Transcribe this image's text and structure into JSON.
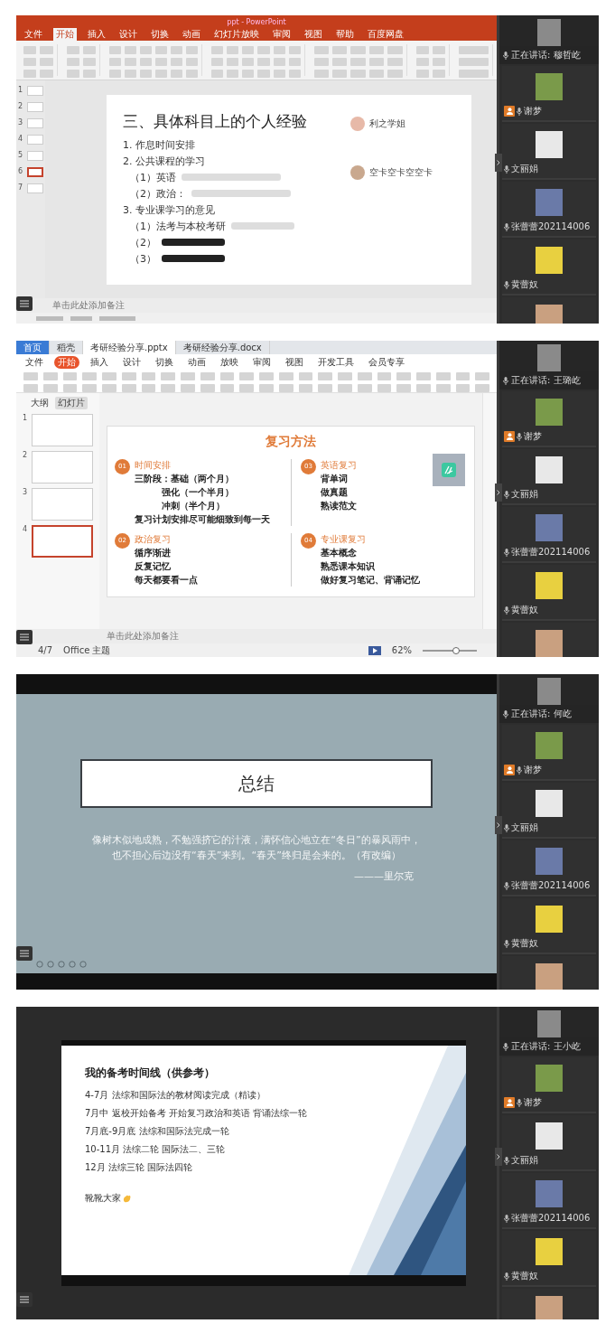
{
  "panels": [
    {
      "kind": "powerpoint",
      "title": "ppt - PowerPoint",
      "menu": [
        {
          "label": "文件",
          "selected": false
        },
        {
          "label": "开始",
          "selected": true
        },
        {
          "label": "插入",
          "selected": false
        },
        {
          "label": "设计",
          "selected": false
        },
        {
          "label": "切换",
          "selected": false
        },
        {
          "label": "动画",
          "selected": false
        },
        {
          "label": "幻灯片放映",
          "selected": false
        },
        {
          "label": "审阅",
          "selected": false
        },
        {
          "label": "视图",
          "selected": false
        },
        {
          "label": "帮助",
          "selected": false
        },
        {
          "label": "百度网盘",
          "selected": false
        }
      ],
      "thumbnails": [
        {
          "number": "1",
          "selected": false
        },
        {
          "number": "2",
          "selected": false
        },
        {
          "number": "3",
          "selected": false
        },
        {
          "number": "4",
          "selected": false
        },
        {
          "number": "5",
          "selected": false
        },
        {
          "number": "6",
          "selected": true
        },
        {
          "number": "7",
          "selected": false
        }
      ],
      "slide": {
        "title": "三、具体科目上的个人经验",
        "lines": [
          {
            "text": "1.  作息时间安排"
          },
          {
            "text": "2.  公共课程的学习",
            "children": [
              {
                "text": "（1）英语"
              },
              {
                "text": "（2）政治："
              }
            ]
          },
          {
            "text": "3. 专业课学习的意见",
            "children": [
              {
                "text": "（1）法考与本校考研"
              },
              {
                "text": "（2）"
              },
              {
                "text": "（3）"
              }
            ]
          }
        ],
        "comments": [
          {
            "name": "利之学姐"
          },
          {
            "name": "空卡空卡空空卡"
          }
        ]
      },
      "notes": "单击此处添加备注",
      "sidebar": {
        "speaking": "正在讲话: 穆哲屹",
        "participants": [
          {
            "name": "谢梦",
            "host": true
          },
          {
            "name": "文丽娟",
            "host": false
          },
          {
            "name": "张蕾蕾202114006",
            "host": false
          },
          {
            "name": "黄蕾奴",
            "host": false
          },
          {
            "host": false
          }
        ]
      }
    },
    {
      "kind": "wps",
      "tabs": [
        {
          "label": "首页",
          "selected": false
        },
        {
          "label": "稻壳",
          "selected": false
        },
        {
          "label": "考研经验分享.pptx",
          "selected": true
        },
        {
          "label": "考研经验分享.docx",
          "selected": false
        }
      ],
      "menu": [
        {
          "label": "文件",
          "selected": false
        },
        {
          "label": "开始",
          "selected": true
        },
        {
          "label": "插入",
          "selected": false
        },
        {
          "label": "设计",
          "selected": false
        },
        {
          "label": "切换",
          "selected": false
        },
        {
          "label": "动画",
          "selected": false
        },
        {
          "label": "放映",
          "selected": false
        },
        {
          "label": "审阅",
          "selected": false
        },
        {
          "label": "视图",
          "selected": false
        },
        {
          "label": "开发工具",
          "selected": false
        },
        {
          "label": "会员专享",
          "selected": false
        }
      ],
      "view_tabs": [
        {
          "label": "大纲",
          "selected": false
        },
        {
          "label": "幻灯片",
          "selected": true
        }
      ],
      "thumbnails": [
        {
          "number": "1",
          "selected": false
        },
        {
          "number": "2",
          "selected": false
        },
        {
          "number": "3",
          "selected": false
        },
        {
          "number": "4",
          "selected": true
        }
      ],
      "slide": {
        "title": "复习方法",
        "sections": [
          {
            "number": "01",
            "heading": "时间安排",
            "lines": [
              {
                "text": "三阶段：基础（两个月）",
                "children": [
                  {
                    "text": "强化（一个半月）"
                  },
                  {
                    "text": "冲刺（半个月）"
                  }
                ]
              },
              {
                "text": "复习计划安排尽可能细致到每一天"
              }
            ]
          },
          {
            "number": "03",
            "heading": "英语复习",
            "lines": [
              {
                "text": "背单词"
              },
              {
                "text": "做真题"
              },
              {
                "text": "熟读范文"
              }
            ]
          },
          {
            "number": "02",
            "heading": "政治复习",
            "lines": [
              {
                "text": "循序渐进"
              },
              {
                "text": "反复记忆"
              },
              {
                "text": "每天都要看一点"
              }
            ]
          },
          {
            "number": "04",
            "heading": "专业课复习",
            "lines": [
              {
                "text": "基本概念"
              },
              {
                "text": "熟悉课本知识"
              },
              {
                "text": "做好复习笔记、背诵记忆"
              }
            ]
          }
        ]
      },
      "notes": "单击此处添加备注",
      "status": {
        "page": "4/7",
        "theme": "Office 主题",
        "zoom": "62%"
      },
      "zoom_slider": {
        "level": 0.62
      },
      "sidebar": {
        "speaking": "正在讲话: 王璐屹",
        "participants": [
          {
            "name": "谢梦",
            "host": true
          },
          {
            "name": "文丽娟",
            "host": false
          },
          {
            "name": "张蕾蕾202114006",
            "host": false
          },
          {
            "name": "黄蕾奴",
            "host": false
          },
          {
            "host": false
          }
        ]
      }
    },
    {
      "kind": "slideshow",
      "slide": {
        "title": "总结",
        "quote_lines": [
          "像树木似地成熟，不勉强挤它的汁液，满怀信心地立在“冬日”的暴风雨中，",
          "也不担心后边没有“春天”来到。“春天”终归是会来的。（有改编）"
        ],
        "author": "———里尔克"
      },
      "sidebar": {
        "speaking": "正在讲话: 何屹",
        "participants": [
          {
            "name": "谢梦",
            "host": true
          },
          {
            "name": "文丽娟",
            "host": false
          },
          {
            "name": "张蕾蕾202114006",
            "host": false
          },
          {
            "name": "黄蕾奴",
            "host": false
          },
          {
            "host": false
          }
        ]
      }
    },
    {
      "kind": "slide",
      "slide": {
        "title": "我的备考时间线（供参考）",
        "lines": [
          "4-7月 法综和国际法的教材阅读完成（精读）",
          "7月中 返校开始备考 开始复习政治和英语 背诵法综一轮",
          "7月底-9月底 法综和国际法完成一轮",
          "10-11月 法综二轮 国际法二、三轮",
          "12月 法综三轮 国际法四轮"
        ],
        "closing": "靴靴大家"
      },
      "sidebar": {
        "speaking": "正在讲话: 王小屹",
        "participants": [
          {
            "name": "谢梦",
            "host": true
          },
          {
            "name": "文丽娟",
            "host": false
          },
          {
            "name": "张蕾蕾202114006",
            "host": false
          },
          {
            "name": "黄蕾奴",
            "host": false
          },
          {
            "host": false
          }
        ]
      }
    }
  ]
}
